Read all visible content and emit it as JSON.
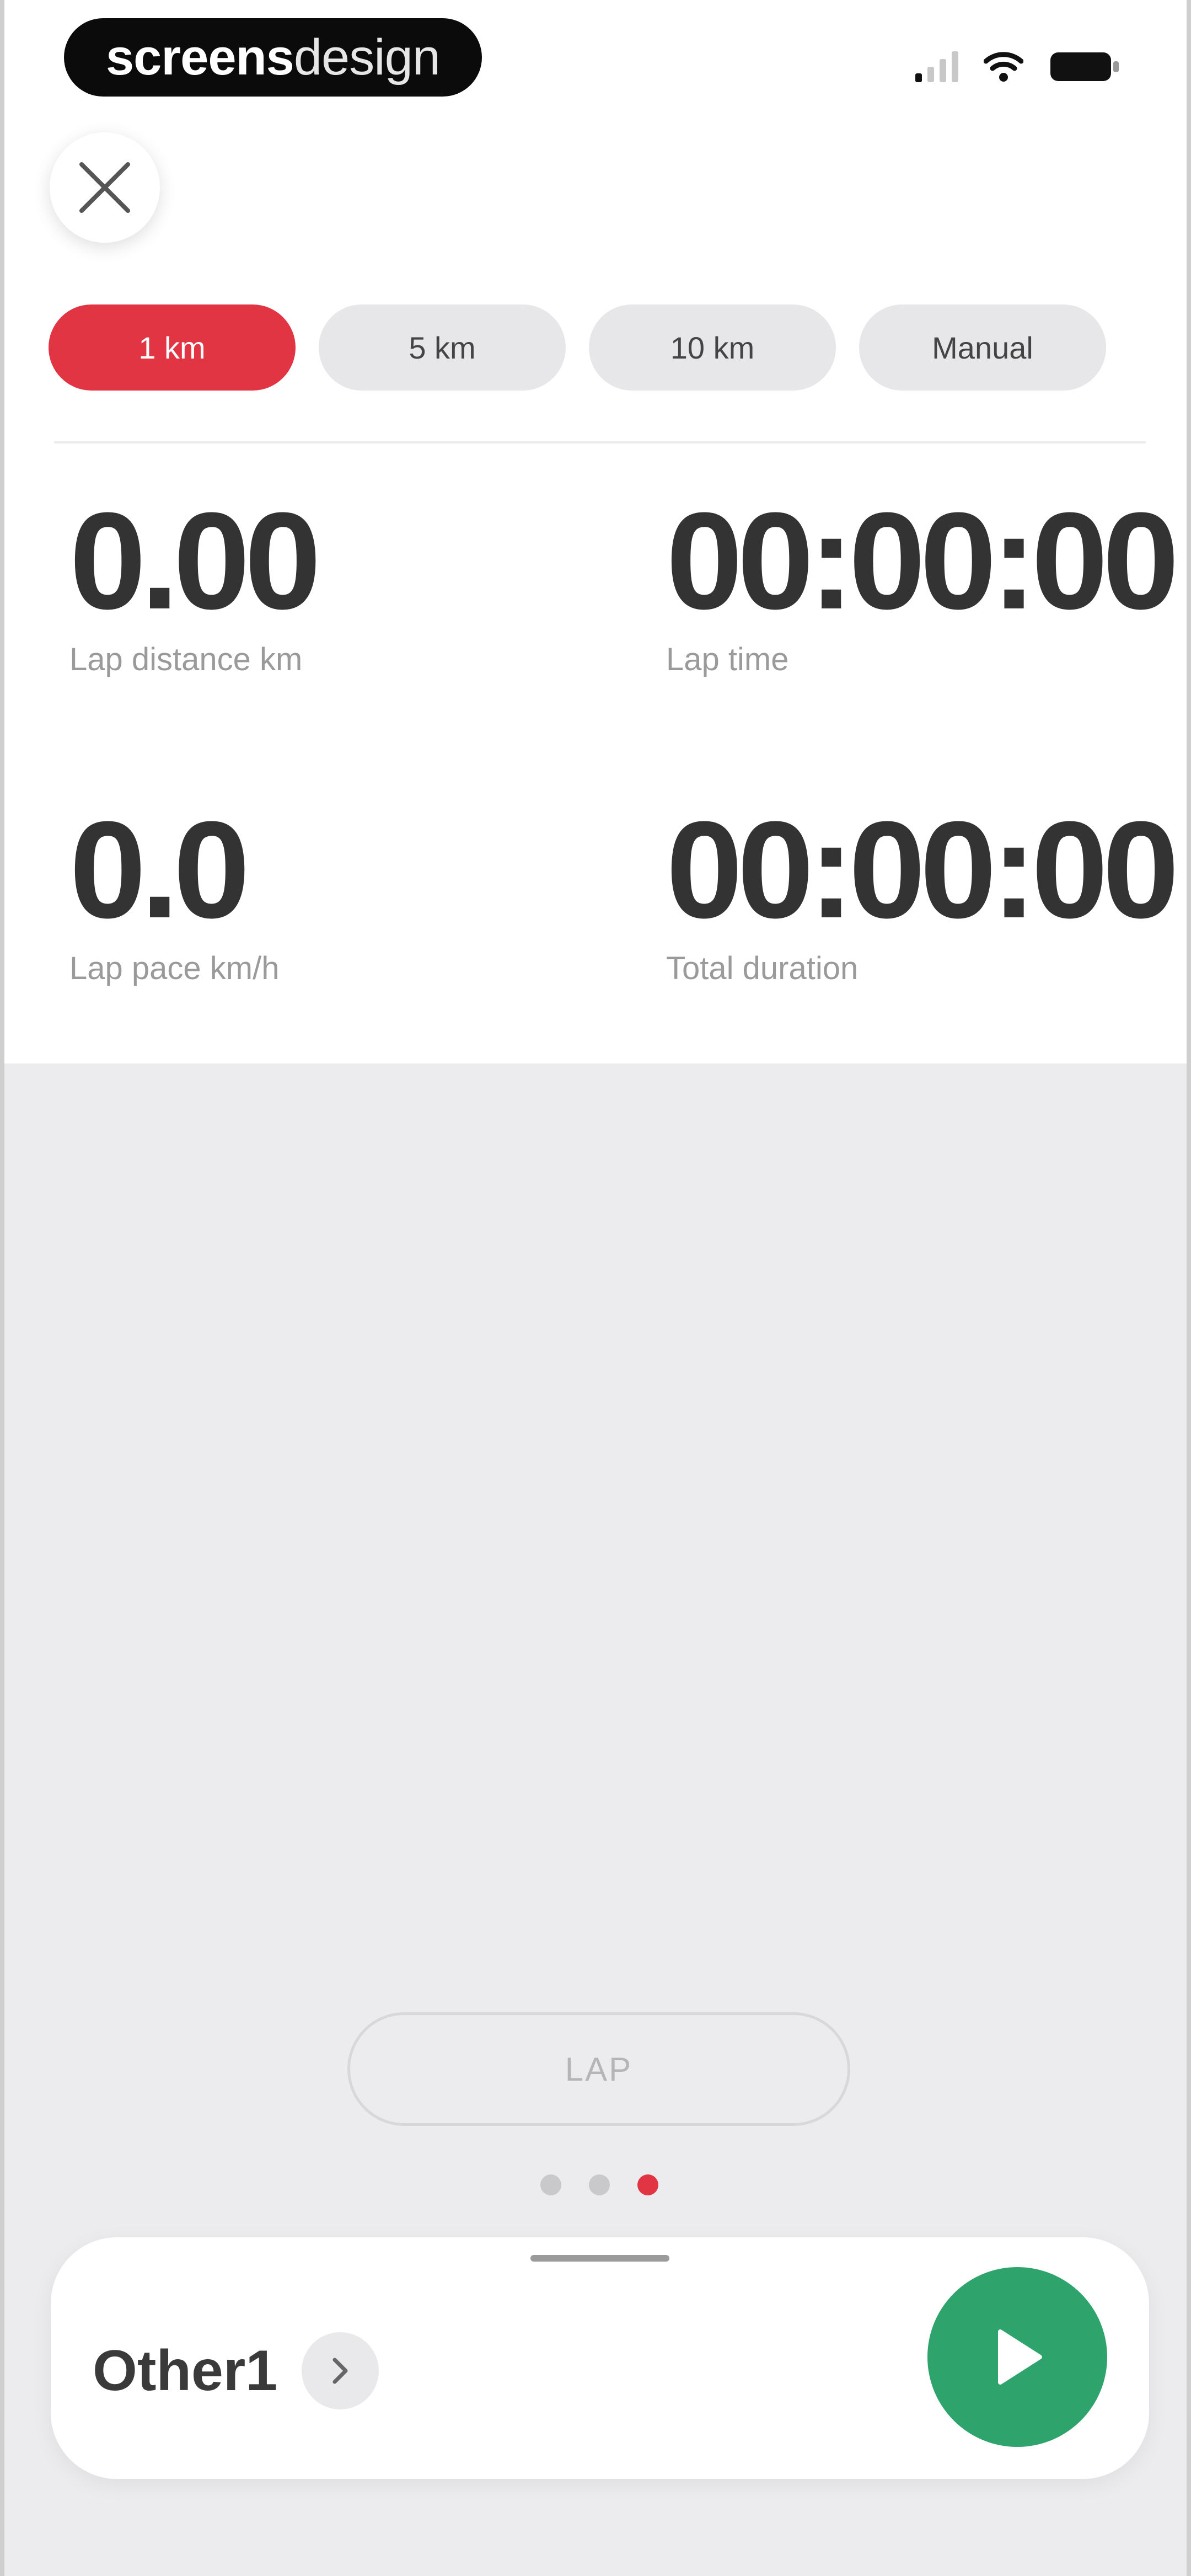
{
  "status_bar": {
    "brand_part1": "screens",
    "brand_part2": "design"
  },
  "tabs": [
    {
      "label": "1 km",
      "active": true
    },
    {
      "label": "5 km",
      "active": false
    },
    {
      "label": "10 km",
      "active": false
    },
    {
      "label": "Manual",
      "active": false
    }
  ],
  "stats": {
    "lap_distance": {
      "value": "0.00",
      "label": "Lap distance km"
    },
    "lap_time": {
      "value": "00:00:00",
      "label": "Lap time"
    },
    "lap_pace": {
      "value": "0.0",
      "label": "Lap pace km/h"
    },
    "total_duration": {
      "value": "00:00:00",
      "label": "Total duration"
    }
  },
  "lap_button": {
    "label": "LAP"
  },
  "page_indicator": {
    "count": 3,
    "active_index": 2
  },
  "bottom_card": {
    "activity_name": "Other1"
  },
  "colors": {
    "accent": "#e23543",
    "start": "#2ea36c"
  },
  "icons": {
    "close": "close-icon",
    "chevron": "chevron-right-icon",
    "play": "play-icon",
    "signal": "signal-icon",
    "wifi": "wifi-icon",
    "battery": "battery-icon"
  }
}
